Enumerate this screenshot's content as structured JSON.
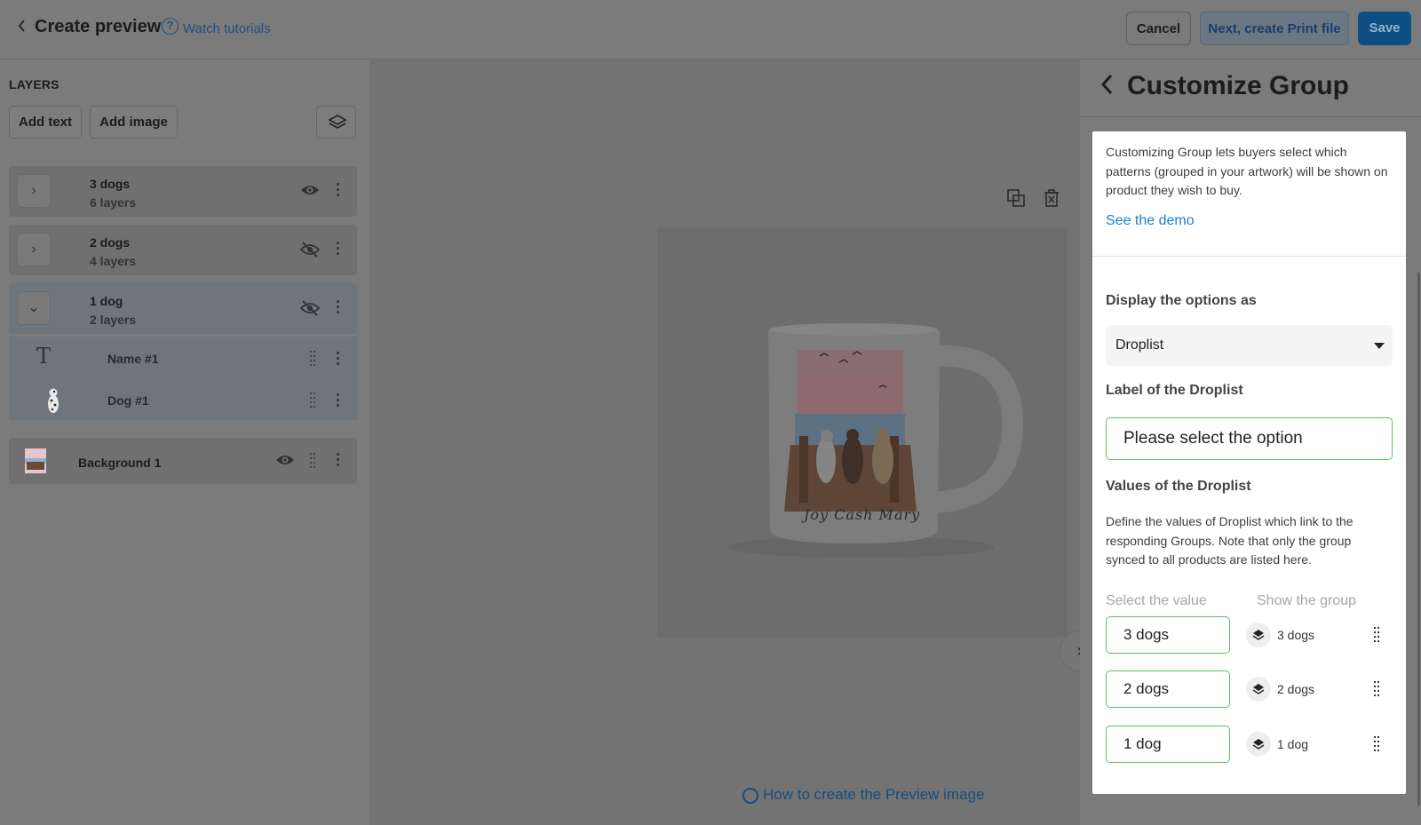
{
  "header": {
    "title": "Create preview",
    "tutorials_link": "Watch tutorials",
    "cancel_label": "Cancel",
    "next_label": "Next, create Print file",
    "save_label": "Save"
  },
  "layers_panel": {
    "title": "LAYERS",
    "add_text_label": "Add text",
    "add_image_label": "Add image",
    "groups": [
      {
        "name": "3 dogs",
        "sub": "6 layers",
        "visible": true,
        "expanded": false
      },
      {
        "name": "2 dogs",
        "sub": "4 layers",
        "visible": false,
        "expanded": false
      },
      {
        "name": "1 dog",
        "sub": "2 layers",
        "visible": false,
        "expanded": true
      }
    ],
    "children": [
      {
        "name": "Name #1",
        "icon": "text-icon"
      },
      {
        "name": "Dog #1",
        "icon": "dog-thumbnail"
      }
    ],
    "background": {
      "name": "Background 1",
      "visible": true
    }
  },
  "canvas": {
    "mug_text": "Joy Cash Mary",
    "preview_link": "How to create the Preview image"
  },
  "customize_panel": {
    "title": "Customize Group",
    "description": "Customizing Group lets buyers select which patterns (grouped in your artwork) will be shown on product they wish to buy.",
    "demo_link": "See the demo",
    "display_label": "Display the options as",
    "display_value": "Droplist",
    "droplist_label_heading": "Label of the Droplist",
    "droplist_label_value": "Please select the option",
    "values_heading": "Values of the Droplist",
    "values_description": "Define the values of Droplist which link to the responding Groups. Note that only the group synced to all products are listed here.",
    "col_value": "Select the value",
    "col_group": "Show the group",
    "rows": [
      {
        "value": "3 dogs",
        "group": "3 dogs"
      },
      {
        "value": "2 dogs",
        "group": "2 dogs"
      },
      {
        "value": "1 dog",
        "group": "1 dog"
      }
    ]
  },
  "colors": {
    "accent": "#0c4f80",
    "link": "#1a7fd0",
    "input_border": "#5cc25e"
  }
}
